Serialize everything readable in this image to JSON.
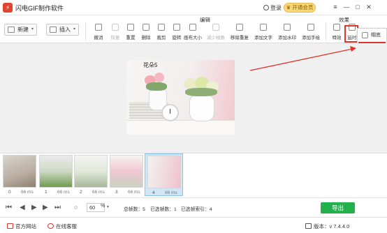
{
  "app": {
    "title": "闪电GIF制作软件",
    "login": "登录",
    "vip": "开通会员",
    "window": {
      "minimize": "—",
      "maximize": "□",
      "close": "✕"
    }
  },
  "ribbon": {
    "new_label": "新建",
    "insert_label": "插入",
    "edit_group": "编辑",
    "effect_group": "效果",
    "tools": [
      "撤消",
      "恢复",
      "重置",
      "删除",
      "裁剪",
      "旋转",
      "画布大小",
      "减少帧数",
      "移除重复",
      "添加文字",
      "添加水印",
      "添加手绘"
    ],
    "disabled_tools": [
      "恢复",
      "减少帧数"
    ],
    "effect_tools": [
      "特效",
      "延时"
    ]
  },
  "menu": {
    "items": [
      "帽底",
      "设置"
    ],
    "highlighted": "设置"
  },
  "preview": {
    "caption": "花朵5"
  },
  "filmstrip": {
    "frames": [
      {
        "index": "0",
        "duration": "66 ms"
      },
      {
        "index": "1",
        "duration": "66 ms"
      },
      {
        "index": "2",
        "duration": "66 ms"
      },
      {
        "index": "3",
        "duration": "66 ms"
      },
      {
        "index": "4",
        "duration": "66 ms"
      }
    ],
    "selected_index": 4
  },
  "controls": {
    "zoom_value": "60",
    "zoom_unit": "%",
    "total_frames": "总帧数：5",
    "selected_frames": "已选帧数：1",
    "selected_frame_index": "已选帧索引：4",
    "export_label": "导出"
  },
  "statusbar": {
    "website": "官方网站",
    "support": "在线客服",
    "version": "版本：v 7.4.4.0"
  },
  "colors": {
    "accent_red": "#e0342b",
    "export_green": "#23b14d",
    "selection_blue": "#cfe6f7"
  }
}
